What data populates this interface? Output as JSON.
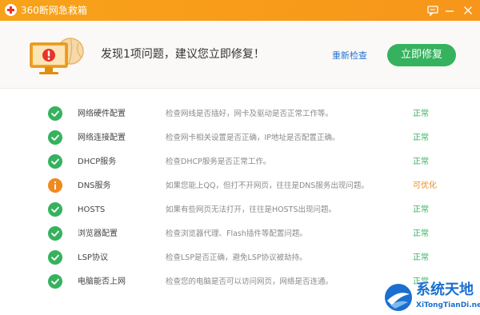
{
  "titlebar": {
    "title": "360断网急救箱",
    "icons": [
      "app-logo-icon",
      "feedback-icon",
      "minimize-icon",
      "close-icon"
    ]
  },
  "header": {
    "headline": "发现1项问题，建议您立即修复！",
    "recheck_label": "重新检查",
    "repair_label": "立即修复",
    "illustration_icon": "monitor-warning-icon"
  },
  "colors": {
    "titlebar": "#f8a21a",
    "ok": "#36b25f",
    "warning": "#f08a1e",
    "link": "#2a74d4"
  },
  "checks": [
    {
      "name": "网络硬件配置",
      "desc": "检查网线是否插好，网卡及驱动是否正常工作等。",
      "status": "正常",
      "state": "ok"
    },
    {
      "name": "网络连接配置",
      "desc": "检查网卡相关设置是否正确，IP地址是否配置正确。",
      "status": "正常",
      "state": "ok"
    },
    {
      "name": "DHCP服务",
      "desc": "检查DHCP服务是否正常工作。",
      "status": "正常",
      "state": "ok"
    },
    {
      "name": "DNS服务",
      "desc": "如果您能上QQ，但打不开网页，往往是DNS服务出现问题。",
      "status": "可优化",
      "state": "warn"
    },
    {
      "name": "HOSTS",
      "desc": "如果有些网页无法打开，往往是HOSTS出现问题。",
      "status": "正常",
      "state": "ok"
    },
    {
      "name": "浏览器配置",
      "desc": "检查浏览器代理、Flash插件等配置问题。",
      "status": "正常",
      "state": "ok"
    },
    {
      "name": "LSP协议",
      "desc": "检查LSP是否正确，避免LSP协议被劫持。",
      "status": "正常",
      "state": "ok"
    },
    {
      "name": "电脑能否上网",
      "desc": "检查您的电脑是否可以访问网页，网络是否连通。",
      "status": "正常",
      "state": "ok"
    }
  ],
  "watermark": {
    "title": "系统天地",
    "url": "XiTongTianDi.net",
    "icon": "watermark-logo-icon"
  }
}
